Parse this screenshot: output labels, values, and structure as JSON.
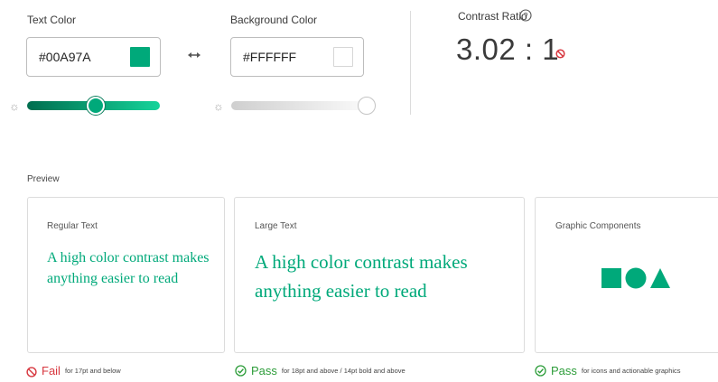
{
  "colors": {
    "text": "#00A97A",
    "background": "#FFFFFF",
    "fail": "#d7373f",
    "pass": "#2d9d3a",
    "slider_dark": "#006e4f",
    "slider_light": "#15d39a"
  },
  "text_color": {
    "label": "Text Color",
    "value": "#00A97A",
    "slider_fraction": 0.52
  },
  "swap_icon": "swap-arrows-icon",
  "background_color": {
    "label": "Background Color",
    "value": "#FFFFFF",
    "slider_fraction": 1.0
  },
  "contrast": {
    "label": "Contrast Ratio",
    "help_icon": "help-icon",
    "ratio": "3.02 : 1",
    "status_icon": "fail-icon"
  },
  "preview": {
    "label": "Preview",
    "regular": {
      "title": "Regular Text",
      "sample": "A high color contrast makes anything easier to read",
      "result": "Fail",
      "note": "for 17pt and below"
    },
    "large": {
      "title": "Large Text",
      "sample": "A high color contrast makes anything easier to read",
      "result": "Pass",
      "note": "for 18pt and above / 14pt bold and above"
    },
    "graphic": {
      "title": "Graphic Components",
      "shapes": [
        "square",
        "circle",
        "triangle"
      ],
      "result": "Pass",
      "note": "for icons and actionable graphics"
    }
  }
}
